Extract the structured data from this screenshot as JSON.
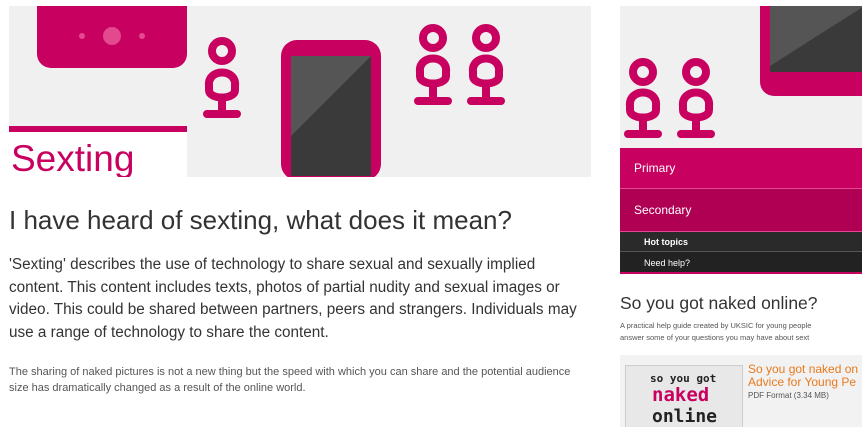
{
  "page": {
    "title": "Sexting"
  },
  "main": {
    "heading": "I have heard of sexting, what does it mean?",
    "lead": "'Sexting' describes the use of technology to share sexual and sexually implied content. This content includes texts, photos of partial nudity and sexual images or video. This could be shared between partners, peers and strangers. Individuals may use a range of technology to share the content.",
    "paragraph": "The sharing of naked pictures is not a new thing but the speed with which you can share and the potential audience size has dramatically changed as a result of the online world."
  },
  "nav": {
    "items": [
      {
        "label": "Primary"
      },
      {
        "label": "Secondary"
      }
    ],
    "subitems": [
      {
        "label": "Hot topics"
      },
      {
        "label": "Need help?"
      }
    ]
  },
  "sidebar": {
    "heading": "So you got naked online?",
    "desc_line1": "A practical help guide created by UKSIC for young people",
    "desc_line2": "answer some of your questions you may have about sext",
    "resource": {
      "title_line1": "So you got naked on",
      "title_line2": "Advice for Young Pe",
      "format": "PDF Format (3.34 MB)",
      "thumb_line1": "so you got",
      "thumb_line2": "naked",
      "thumb_line3": "online"
    }
  },
  "colors": {
    "brand": "#c8005f",
    "brand_dark": "#b00053",
    "link": "#e87a1e",
    "banner_bg": "#f0f0f0"
  }
}
